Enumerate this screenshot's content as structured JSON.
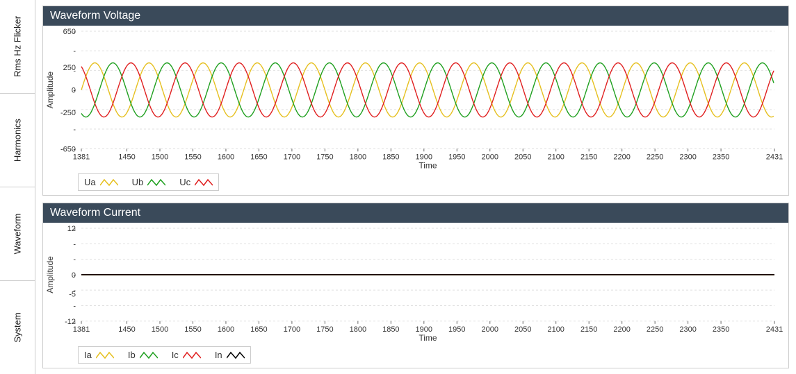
{
  "sidebar": {
    "tabs": [
      {
        "id": "rms",
        "label": "Rms Hz Flicker"
      },
      {
        "id": "harmonics",
        "label": "Harmonics"
      },
      {
        "id": "waveform",
        "label": "Waveform"
      },
      {
        "id": "system",
        "label": "System"
      }
    ]
  },
  "colors": {
    "a": "#e6c020",
    "b": "#20a020",
    "c": "#e02020",
    "n": "#000000",
    "grid": "#e0e0e0",
    "axis": "#666"
  },
  "panels": [
    {
      "id": "voltage",
      "title": "Waveform Voltage",
      "legend": [
        {
          "name": "Ua",
          "colorKey": "a"
        },
        {
          "name": "Ub",
          "colorKey": "b"
        },
        {
          "name": "Uc",
          "colorKey": "c"
        }
      ]
    },
    {
      "id": "current",
      "title": "Waveform Current",
      "legend": [
        {
          "name": "Ia",
          "colorKey": "a"
        },
        {
          "name": "Ib",
          "colorKey": "b"
        },
        {
          "name": "Ic",
          "colorKey": "c"
        },
        {
          "name": "In",
          "colorKey": "n"
        }
      ]
    }
  ],
  "chart_data": [
    {
      "id": "voltage",
      "type": "line",
      "title": "Waveform Voltage",
      "xlabel": "Time",
      "ylabel": "Amplitude",
      "xlim": [
        1381,
        2431
      ],
      "ylim": [
        -650,
        650
      ],
      "xticks": [
        1381,
        1450,
        1500,
        1550,
        1600,
        1650,
        1700,
        1750,
        1800,
        1850,
        1900,
        1950,
        2000,
        2050,
        2100,
        2150,
        2200,
        2250,
        2300,
        2350,
        2431
      ],
      "yticks": [
        -650,
        -250,
        0,
        250,
        650
      ],
      "yticks_minor_text": "-",
      "amplitude": 300,
      "period_x": 82,
      "series": [
        {
          "name": "Ua",
          "color": "#e6c020",
          "phase_deg": 0
        },
        {
          "name": "Ub",
          "color": "#20a020",
          "phase_deg": -120
        },
        {
          "name": "Uc",
          "color": "#e02020",
          "phase_deg": 120
        }
      ]
    },
    {
      "id": "current",
      "type": "line",
      "title": "Waveform Current",
      "xlabel": "Time",
      "ylabel": "Amplitude",
      "xlim": [
        1381,
        2431
      ],
      "ylim": [
        -12,
        12
      ],
      "xticks": [
        1381,
        1450,
        1500,
        1550,
        1600,
        1650,
        1700,
        1750,
        1800,
        1850,
        1900,
        1950,
        2000,
        2050,
        2100,
        2150,
        2200,
        2250,
        2300,
        2350,
        2431
      ],
      "yticks": [
        -12,
        -5,
        0,
        12
      ],
      "yticks_minor_text": "-",
      "flat_value": 0,
      "series": [
        {
          "name": "Ia",
          "color": "#e6c020"
        },
        {
          "name": "Ib",
          "color": "#20a020"
        },
        {
          "name": "Ic",
          "color": "#e02020"
        },
        {
          "name": "In",
          "color": "#000000"
        }
      ]
    }
  ]
}
